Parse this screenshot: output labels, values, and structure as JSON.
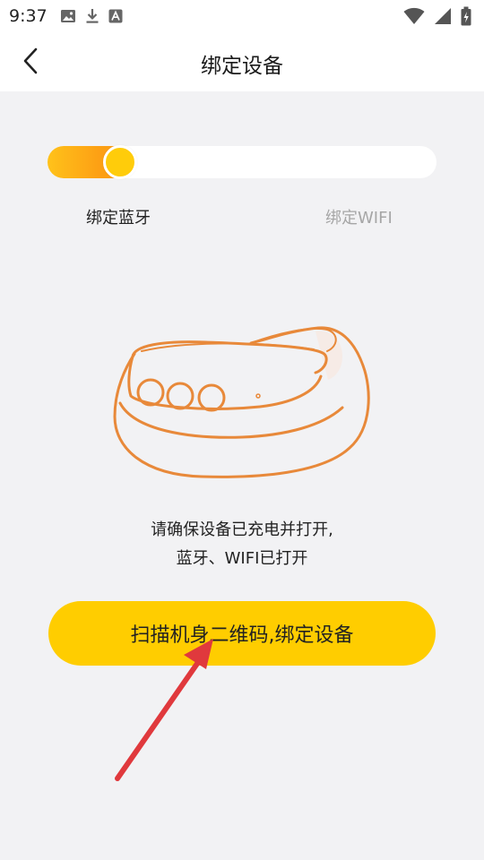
{
  "status_bar": {
    "time": "9:37",
    "left_icons": [
      "image-icon",
      "download-icon",
      "font-a-icon"
    ],
    "right_icons": [
      "wifi-icon",
      "signal-icon",
      "battery-charging-icon"
    ]
  },
  "nav": {
    "back_icon": "chevron-left-icon",
    "title": "绑定设备"
  },
  "progress": {
    "steps": [
      {
        "label": "绑定蓝牙",
        "active": true
      },
      {
        "label": "绑定WIFI",
        "active": false
      }
    ],
    "value": 0.2,
    "colors": {
      "fill_start": "#ffc21a",
      "fill_end": "#f79a16",
      "knob": "#ffcc0a"
    }
  },
  "illustration": {
    "icon": "smart-device-illustration",
    "stroke_color": "#e8893a"
  },
  "instruction": {
    "line1": "请确保设备已充电并打开,",
    "line2": "蓝牙、WIFI已打开"
  },
  "primary_action": {
    "label": "扫描机身二维码,绑定设备",
    "color": "#ffcd00"
  },
  "annotation": {
    "icon": "red-arrow-annotation",
    "color": "#e0393d"
  }
}
